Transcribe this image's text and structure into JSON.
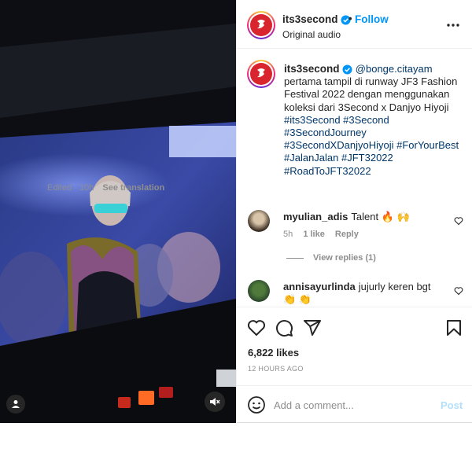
{
  "header": {
    "username": "its3second",
    "follow_label": "Follow",
    "separator": "•",
    "audio_label": "Original audio",
    "logo_text": "3SECOND"
  },
  "caption": {
    "username": "its3second",
    "mention": "@bonge.citayam",
    "text": "pertama tampil di runway JF3 Fashion Festival 2022 dengan menggunakan koleksi dari 3Second x Danjyo Hiyoji",
    "hashtags": "#its3Second #3Second #3SecondJourney #3SecondXDanjyoHiyoji #ForYourBest #JalanJalan #JFT32022 #RoadToJFT32022",
    "edited_time": "Edited · 10h",
    "see_translation": "See translation"
  },
  "comments": [
    {
      "username": "myulian_adis",
      "text": "Talent 🔥 🙌",
      "time": "5h",
      "likes": "1 like",
      "reply_label": "Reply",
      "view_replies": "View replies (1)"
    },
    {
      "username": "annisayurlinda",
      "text": "jujurly keren bgt 👏 👏"
    }
  ],
  "likes": "6,822 likes",
  "post_time": "12 HOURS AGO",
  "add_comment": {
    "placeholder": "Add a comment...",
    "post_label": "Post"
  },
  "colors": {
    "accent": "#0095f6",
    "link": "#00376b",
    "brand_red": "#d9252d",
    "muted": "#8e8e8e"
  },
  "icons": [
    "user-tag-icon",
    "mute-icon",
    "verified-icon",
    "more-icon",
    "heart-icon",
    "comment-icon",
    "share-icon",
    "bookmark-icon",
    "emoji-icon"
  ]
}
